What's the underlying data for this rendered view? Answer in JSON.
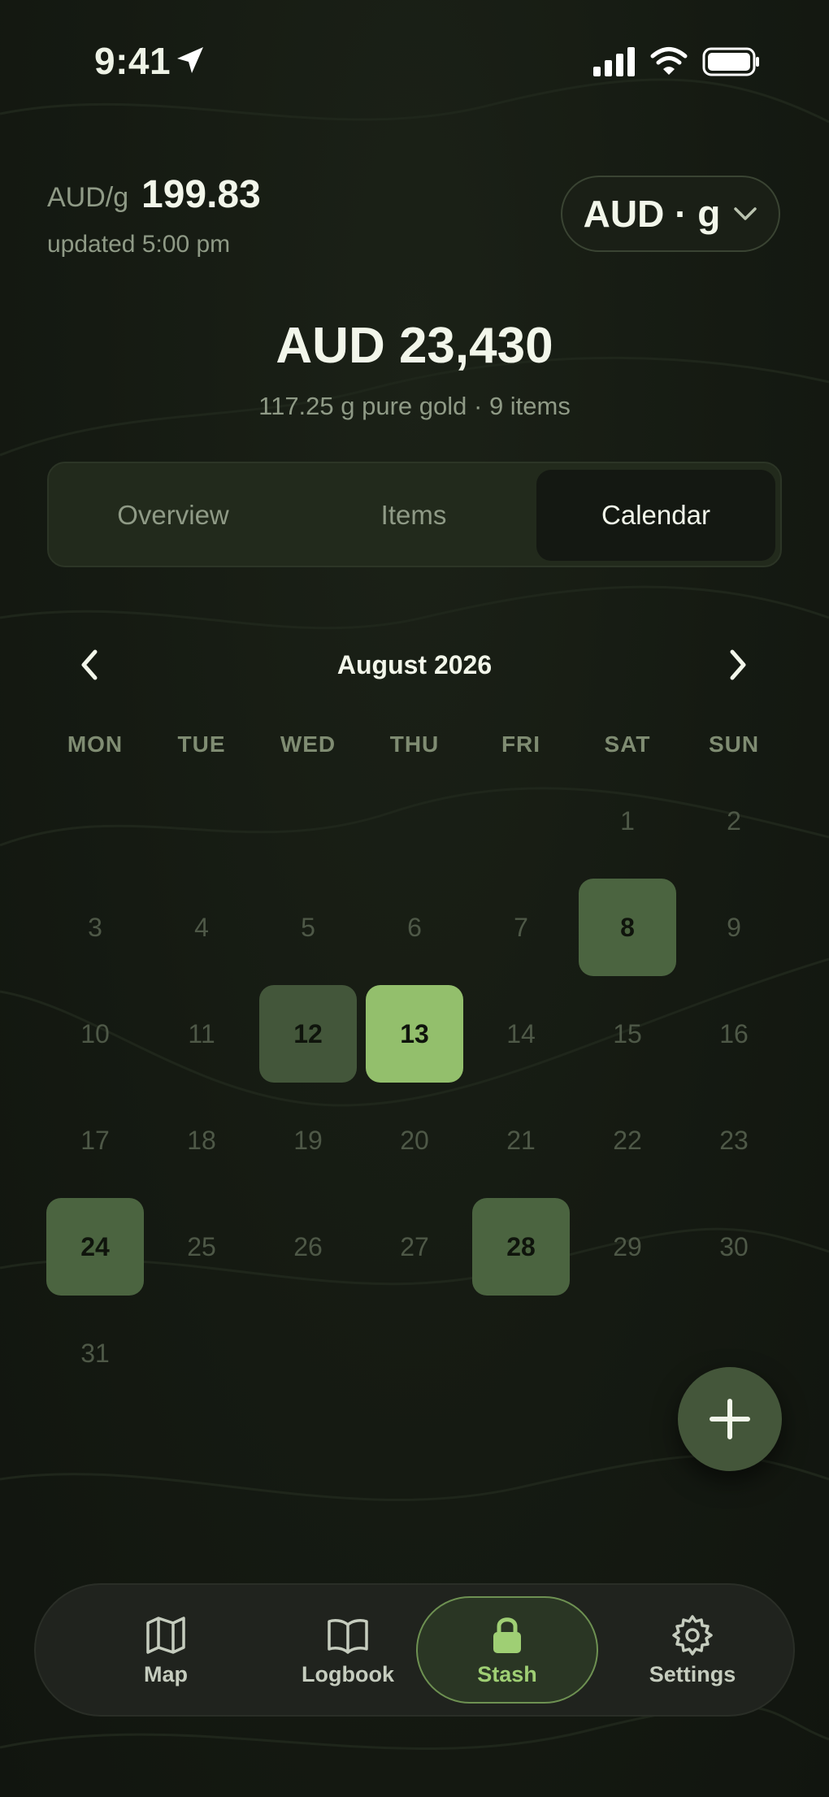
{
  "status_bar": {
    "time": "9:41"
  },
  "header": {
    "unit_label": "AUD/g",
    "price": "199.83",
    "updated": "updated 5:00 pm",
    "unit_selector": "AUD · g"
  },
  "summary": {
    "total": "AUD 23,430",
    "subtitle": "117.25 g pure gold · 9 items"
  },
  "tabs": [
    {
      "label": "Overview",
      "active": false
    },
    {
      "label": "Items",
      "active": false
    },
    {
      "label": "Calendar",
      "active": true
    }
  ],
  "calendar": {
    "month_label": "August 2026",
    "weekdays": [
      "MON",
      "TUE",
      "WED",
      "THU",
      "FRI",
      "SAT",
      "SUN"
    ],
    "first_weekday_index": 5,
    "days_in_month": 31,
    "highlighted": [
      {
        "day": 8,
        "level": 2
      },
      {
        "day": 12,
        "level": 1
      },
      {
        "day": 13,
        "level": 3
      },
      {
        "day": 24,
        "level": 2
      },
      {
        "day": 28,
        "level": 2
      }
    ]
  },
  "fab": {
    "icon": "plus-icon"
  },
  "bottom_nav": [
    {
      "label": "Map",
      "icon": "map-icon",
      "active": false
    },
    {
      "label": "Logbook",
      "icon": "book-icon",
      "active": false
    },
    {
      "label": "Stash",
      "icon": "lock-icon",
      "active": true
    },
    {
      "label": "Settings",
      "icon": "gear-icon",
      "active": false
    }
  ],
  "colors": {
    "background": "#141811",
    "accent": "#93bf6c",
    "highlight_dark": "#43563a",
    "highlight_mid": "#4b6440"
  }
}
